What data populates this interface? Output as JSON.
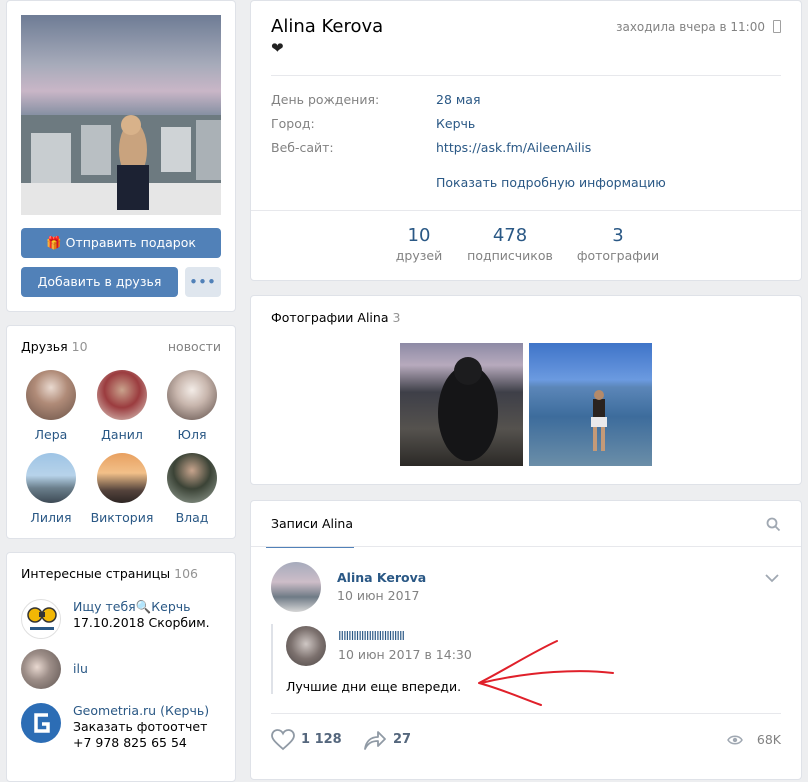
{
  "profile": {
    "name": "Alina Kerova",
    "status_emoji": "❤",
    "last_seen": "заходила вчера в 11:00",
    "fields": [
      {
        "label": "День рождения:",
        "value": "28 мая"
      },
      {
        "label": "Город:",
        "value": "Керчь"
      },
      {
        "label": "Веб-сайт:",
        "value": "https://ask.fm/AileenAilis"
      }
    ],
    "more_info": "Показать подробную информацию",
    "counters": [
      {
        "value": "10",
        "label": "друзей"
      },
      {
        "value": "478",
        "label": "подписчиков"
      },
      {
        "value": "3",
        "label": "фотографии"
      }
    ]
  },
  "actions": {
    "gift": "Отправить подарок",
    "add_friend": "Добавить в друзья",
    "more": "•••"
  },
  "friends": {
    "title": "Друзья",
    "count": "10",
    "news_link": "новости",
    "items": [
      {
        "name": "Лера"
      },
      {
        "name": "Данил"
      },
      {
        "name": "Юля"
      },
      {
        "name": "Лилия"
      },
      {
        "name": "Виктория"
      },
      {
        "name": "Влад"
      }
    ]
  },
  "pages": {
    "title": "Интересные страницы",
    "count": "106",
    "items": [
      {
        "name": "Ищу тебя🔍Керчь",
        "sub": "17.10.2018 Скорбим."
      },
      {
        "name": "ilu",
        "sub": ""
      },
      {
        "name": "Geometria.ru (Керчь)",
        "sub": "Заказать фотоотчет +7 978 825 65 54"
      }
    ]
  },
  "photos": {
    "title": "Фотографии Alina",
    "count": "3"
  },
  "wall": {
    "tab": "Записи Alina",
    "post": {
      "author": "Alina Kerova",
      "date": "10 июн 2017",
      "repost_author": "IIIIIIIIIIIIIIIIIIIIIIIIII",
      "repost_date": "10 июн 2017 в 14:30",
      "text": "Лучшие дни еще впереди.",
      "likes": "1 128",
      "shares": "27",
      "views": "68K"
    }
  },
  "colors": {
    "accent": "#5181b8",
    "link": "#2a5885",
    "annotation": "#e0202a"
  }
}
